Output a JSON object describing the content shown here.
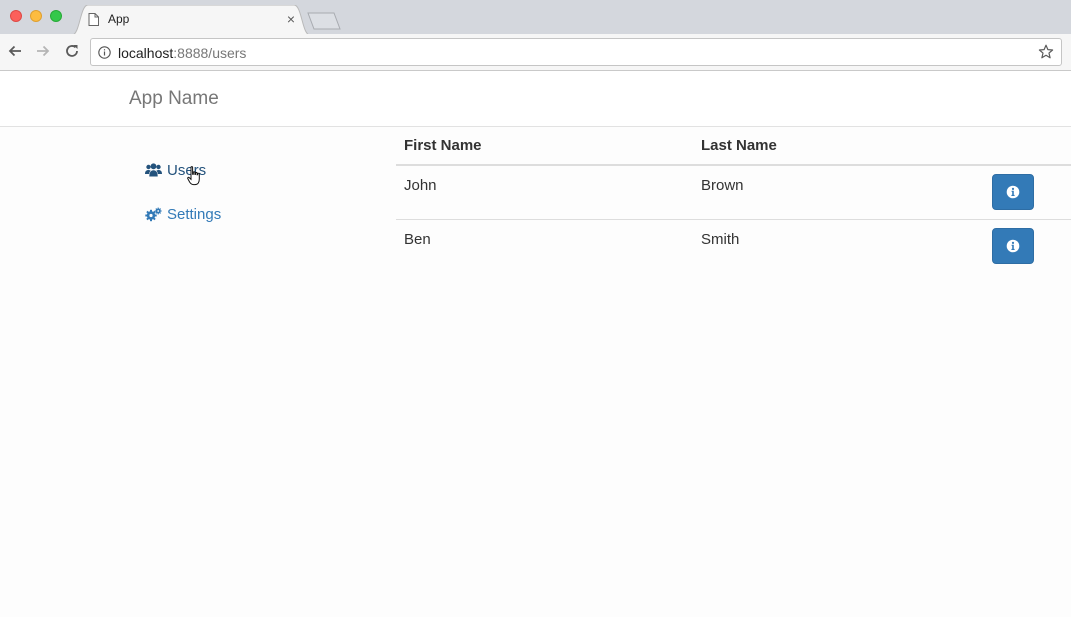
{
  "browser": {
    "tab_title": "App",
    "tab_close": "×",
    "url_host": "localhost",
    "url_rest": ":8888/users"
  },
  "app": {
    "brand": "App Name",
    "sidebar": [
      {
        "label": "Users",
        "icon": "users-icon",
        "active": true
      },
      {
        "label": "Settings",
        "icon": "cogs-icon",
        "active": false
      }
    ],
    "table": {
      "headers": [
        "First Name",
        "Last Name"
      ],
      "rows": [
        {
          "first": "John",
          "last": "Brown",
          "action_icon": "info-icon"
        },
        {
          "first": "Ben",
          "last": "Smith",
          "action_icon": "info-icon"
        }
      ]
    }
  },
  "colors": {
    "primary": "#337ab7",
    "link_active": "#23527c",
    "brand_text": "#777777"
  }
}
